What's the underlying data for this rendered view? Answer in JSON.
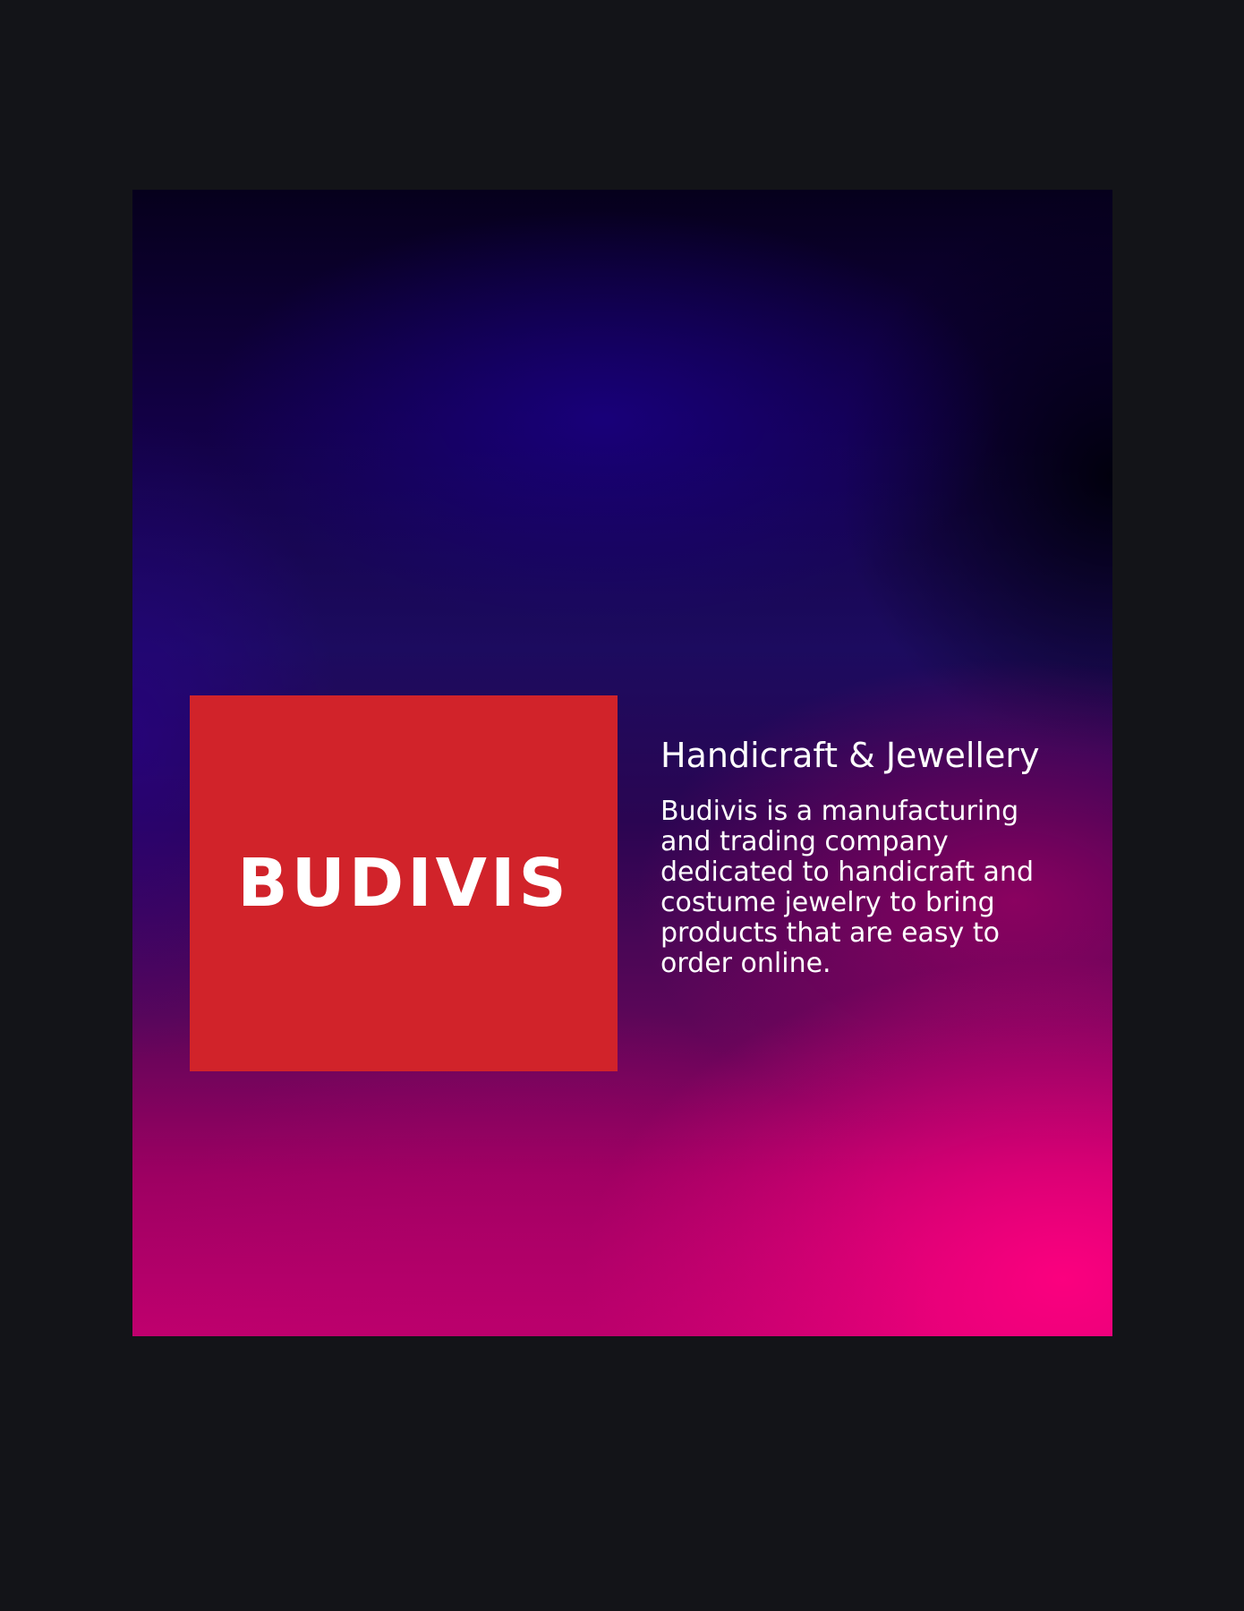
{
  "brand": {
    "name": "BUDIVIS",
    "logo_color": "#d1232a"
  },
  "hero": {
    "tagline": "Handicraft & Jewellery",
    "description": "Budivis is a manufacturing and trading company dedicated to handicraft and costume jewelry to bring products that are easy to order online."
  },
  "colors": {
    "page_background": "#131418",
    "gradient_top": "#06001c",
    "gradient_mid": "#1c0b5f",
    "gradient_bottom": "#ff0080"
  }
}
